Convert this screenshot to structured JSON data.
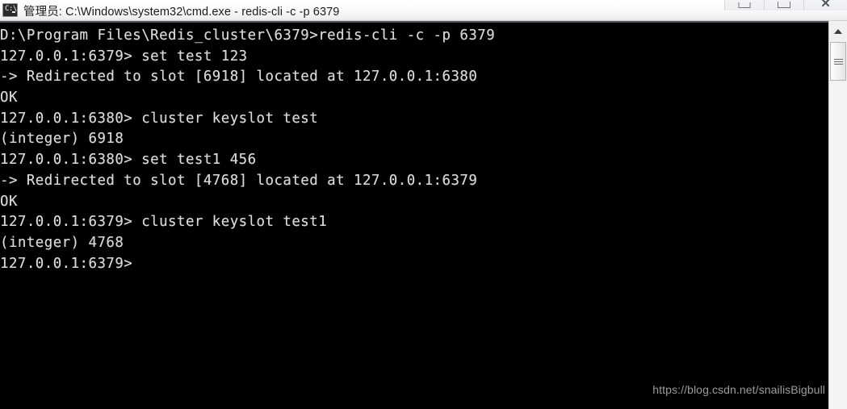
{
  "window": {
    "title": "管理员: C:\\Windows\\system32\\cmd.exe - redis-cli  -c -p 6379",
    "icon": "cmd-console-icon",
    "icon_glyph": "C:\\",
    "controls": {
      "minimize_label": "",
      "maximize_label": "",
      "close_label": "✕"
    }
  },
  "terminal": {
    "lines": [
      "D:\\Program Files\\Redis_cluster\\6379>redis-cli -c -p 6379",
      "127.0.0.1:6379> set test 123",
      "-> Redirected to slot [6918] located at 127.0.0.1:6380",
      "OK",
      "127.0.0.1:6380> cluster keyslot test",
      "(integer) 6918",
      "127.0.0.1:6380> set test1 456",
      "-> Redirected to slot [4768] located at 127.0.0.1:6379",
      "OK",
      "127.0.0.1:6379> cluster keyslot test1",
      "(integer) 4768",
      "127.0.0.1:6379>"
    ],
    "background_color": "#000000",
    "text_color": "#d8d8d8"
  },
  "watermark": {
    "text": "https://blog.csdn.net/snailisBigbull"
  },
  "scrollbar": {
    "up_arrow": "scroll-up-arrow-icon",
    "thumb": "scroll-thumb"
  }
}
